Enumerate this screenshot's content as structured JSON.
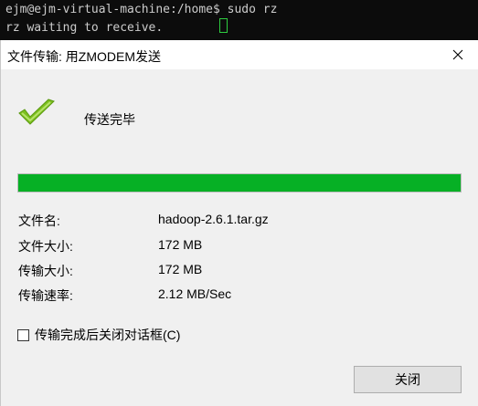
{
  "terminal": {
    "prompt": "ejm@ejm-virtual-machine:/home$ sudo rz",
    "output": "rz waiting to receive."
  },
  "dialog": {
    "title": "文件传输: 用ZMODEM发送",
    "status": "传送完毕",
    "progress_percent": 100,
    "info": [
      {
        "label": "文件名:",
        "value": "hadoop-2.6.1.tar.gz"
      },
      {
        "label": "文件大小:",
        "value": "172 MB"
      },
      {
        "label": "传输大小:",
        "value": "172 MB"
      },
      {
        "label": "传输速率:",
        "value": "2.12 MB/Sec"
      }
    ],
    "checkbox_label": "传输完成后关闭对话框(C)",
    "checkbox_checked": false,
    "close_button": "关闭"
  },
  "colors": {
    "progress_fill": "#06b025",
    "check_mark": "#7dbf1f"
  },
  "icons": {
    "status": "check-icon",
    "window_close": "close-icon"
  }
}
